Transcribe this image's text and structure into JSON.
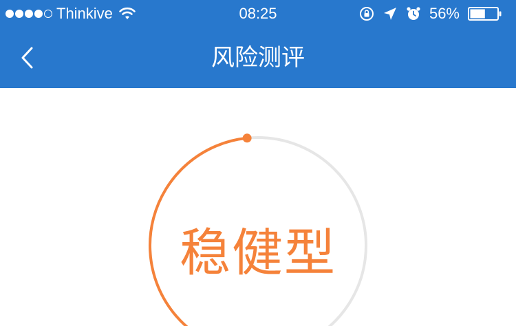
{
  "status_bar": {
    "carrier": "Thinkive",
    "time": "08:25",
    "battery_percent": "56%",
    "battery_level": 0.56,
    "signal_bars_filled": 4,
    "signal_bars_total": 5,
    "icons": [
      "wifi-icon",
      "orientation-lock-icon",
      "location-arrow-icon",
      "alarm-icon",
      "battery-icon"
    ]
  },
  "nav": {
    "title": "风险测评",
    "back_icon": "chevron-left-icon"
  },
  "result": {
    "label": "稳健型",
    "gauge_level": 0.48
  },
  "colors": {
    "header": "#2878cd",
    "accent": "#f5823a",
    "track": "#e6e6e6",
    "background": "#ffffff"
  }
}
